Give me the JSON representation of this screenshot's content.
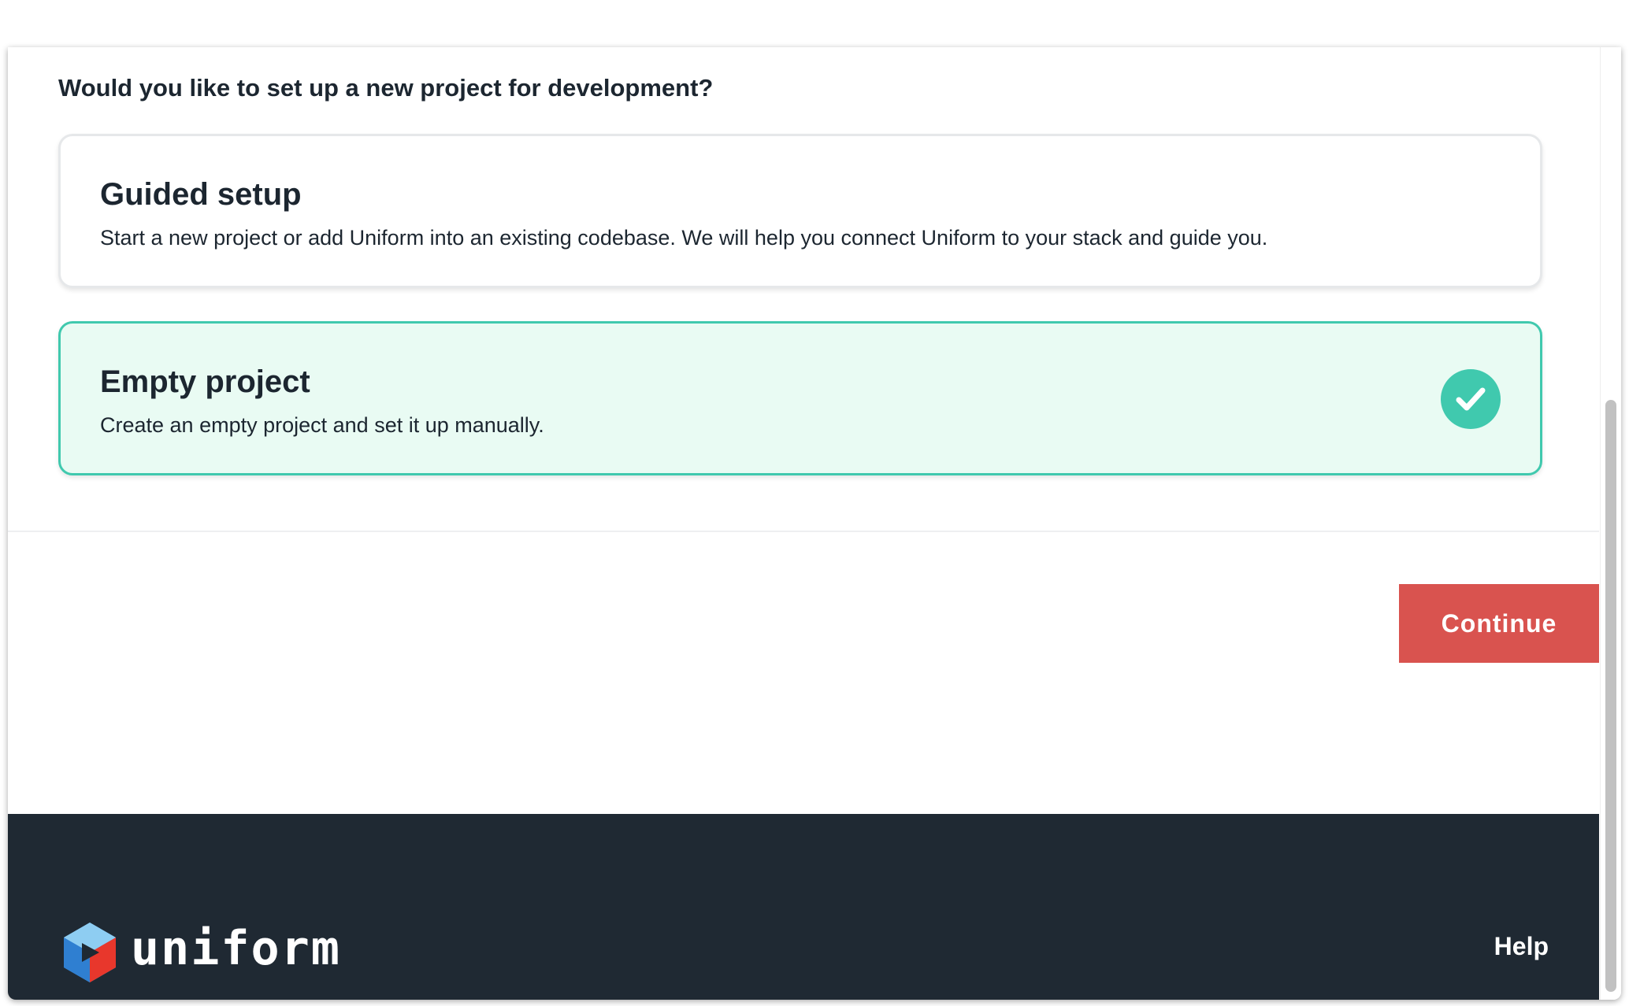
{
  "question": "Would you like to set up a new project for development?",
  "options": [
    {
      "title": "Guided setup",
      "description": "Start a new project or add Uniform into an existing codebase. We will help you connect Uniform to your stack and guide you.",
      "selected": false
    },
    {
      "title": "Empty project",
      "description": "Create an empty project and set it up manually.",
      "selected": true,
      "selected_icon": "check-icon"
    }
  ],
  "actions": {
    "continue_label": "Continue"
  },
  "footer": {
    "brand": "uniform",
    "logo_icon": "uniform-logo-icon",
    "help_label": "Help"
  },
  "colors": {
    "accent_teal": "#40c9ae",
    "selected_bg": "#e9fbf3",
    "continue_red": "#d9534f",
    "footer_bg": "#1f2933",
    "text_dark": "#1c2630"
  }
}
